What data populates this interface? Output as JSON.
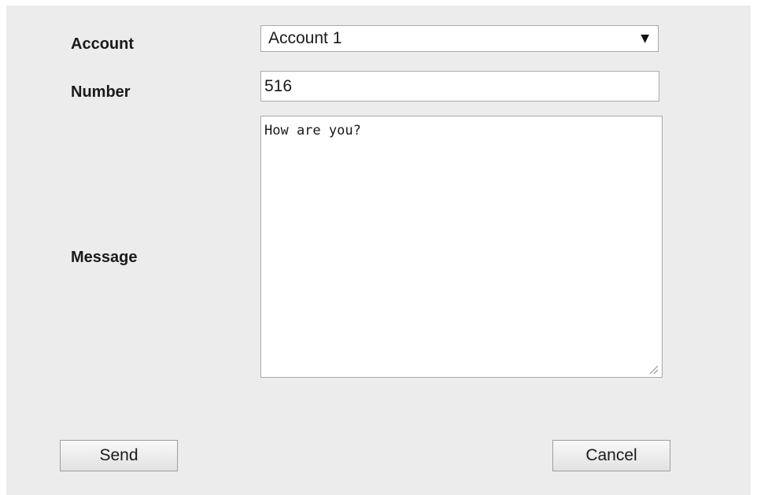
{
  "form": {
    "account": {
      "label": "Account",
      "selected": "Account 1",
      "arrow_icon": "dropdown-arrow-icon"
    },
    "number": {
      "label": "Number",
      "value": "516"
    },
    "message": {
      "label": "Message",
      "value": "How are you?"
    }
  },
  "buttons": {
    "send_label": "Send",
    "cancel_label": "Cancel"
  },
  "colors": {
    "panel_background": "#ececec",
    "field_border": "#a9a9a9"
  }
}
